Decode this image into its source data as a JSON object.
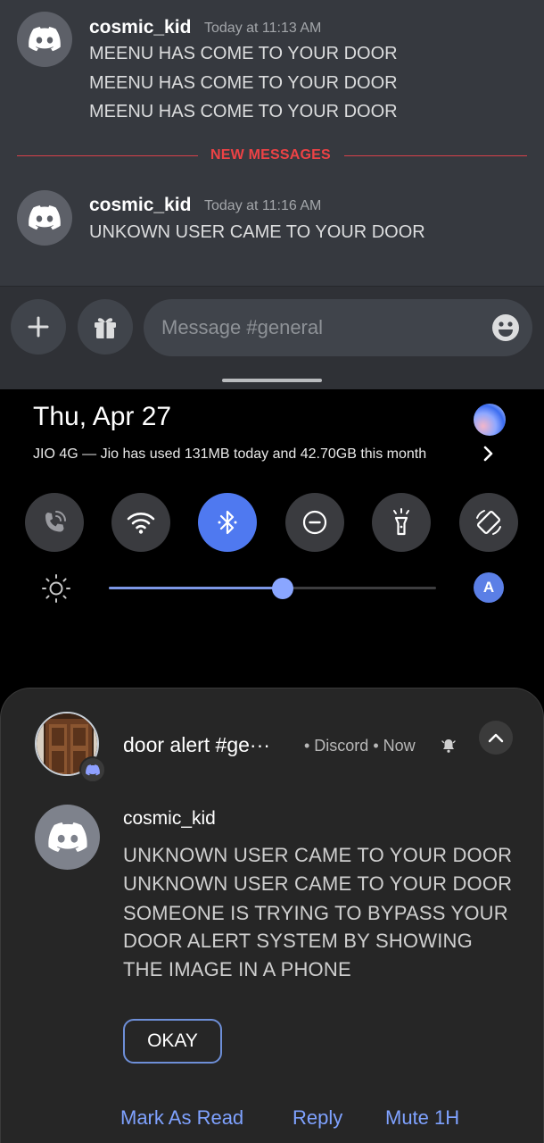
{
  "discord": {
    "messages_before": {
      "username": "cosmic_kid",
      "timestamp": "Today at 11:13 AM",
      "lines": [
        "MEENU HAS COME TO YOUR DOOR",
        "MEENU HAS COME TO YOUR DOOR",
        "MEENU HAS COME TO YOUR DOOR"
      ]
    },
    "divider_label": "NEW MESSAGES",
    "messages_after": {
      "username": "cosmic_kid",
      "timestamp": "Today at 11:16 AM",
      "lines": [
        "UNKOWN USER CAME TO YOUR DOOR"
      ]
    },
    "composer": {
      "placeholder": "Message #general"
    },
    "colors": {
      "background": "#36393f",
      "composer": "#2f3136",
      "new_messages": "#ed4245"
    }
  },
  "quick_settings": {
    "date": "Thu, Apr 27",
    "network_info": "JIO 4G — Jio has used 131MB today and 42.70GB this month",
    "tiles": [
      {
        "icon": "wifi-calling-icon",
        "active": false
      },
      {
        "icon": "wifi-icon",
        "active": true
      },
      {
        "icon": "bluetooth-icon",
        "active": true
      },
      {
        "icon": "do-not-disturb-icon",
        "active": false
      },
      {
        "icon": "flashlight-icon",
        "active": false
      },
      {
        "icon": "auto-rotate-icon",
        "active": false
      }
    ],
    "brightness_level": 0.53,
    "auto_brightness_label": "A",
    "accent": "#4f79f0"
  },
  "notification": {
    "title": "door alert #ge···",
    "app": "• Discord • Now",
    "sender": "cosmic_kid",
    "body_lines": [
      "UNKNOWN USER CAME TO YOUR DOOR",
      "UNKNOWN USER CAME TO YOUR DOOR",
      "SOMEONE IS TRYING TO BYPASS YOUR",
      "DOOR ALERT SYSTEM BY SHOWING",
      "THE IMAGE IN A PHONE"
    ],
    "button_label": "OKAY",
    "actions": [
      "Mark As Read",
      "Reply",
      "Mute 1H"
    ]
  }
}
